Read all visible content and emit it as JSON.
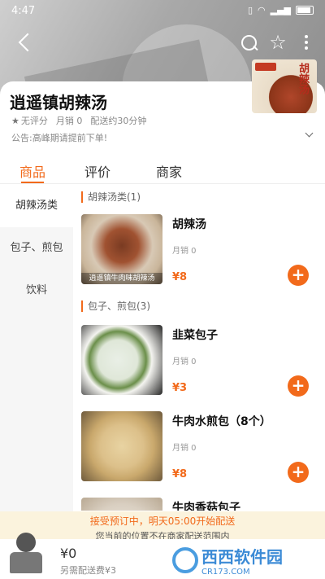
{
  "status_bar": {
    "time": "4:47",
    "signal": "Wi-Fi",
    "battery": ""
  },
  "store": {
    "name": "逍遥镇胡辣汤",
    "rating": "无评分",
    "monthly_sales": "月销 0",
    "delivery_time": "配送约30分钟",
    "notice": "公告:高峰期请提前下单!",
    "logo_text": "胡辣汤"
  },
  "tabs": [
    {
      "label": "商品",
      "active": true
    },
    {
      "label": "评价",
      "active": false
    },
    {
      "label": "商家",
      "active": false
    }
  ],
  "sidebar": [
    {
      "label": "胡辣汤类",
      "active": true
    },
    {
      "label": "包子、煎包",
      "active": false
    },
    {
      "label": "饮料",
      "active": false
    }
  ],
  "categories": [
    {
      "header": "胡辣汤类(1)",
      "products": [
        {
          "name": "胡辣汤",
          "sales": "月销 0",
          "price": "¥8",
          "image_caption": "逍遥镇牛肉味胡辣汤"
        }
      ]
    },
    {
      "header": "包子、煎包(3)",
      "products": [
        {
          "name": "韭菜包子",
          "sales": "月销 0",
          "price": "¥3"
        },
        {
          "name": "牛肉水煎包（8个）",
          "sales": "月销 0",
          "price": "¥8"
        },
        {
          "name": "牛肉香菇包子"
        }
      ]
    }
  ],
  "preorder": {
    "line1": "接受预订中，明天05:00开始配送",
    "line2": "您当前的位置不在商家配送范围内"
  },
  "cart": {
    "total": "¥0",
    "fee": "另需配送费¥3"
  },
  "watermark": {
    "title": "西西软件园",
    "sub": "CR173.COM"
  },
  "colors": {
    "accent": "#f26a1b",
    "notice_bg": "#fbf3dd"
  }
}
